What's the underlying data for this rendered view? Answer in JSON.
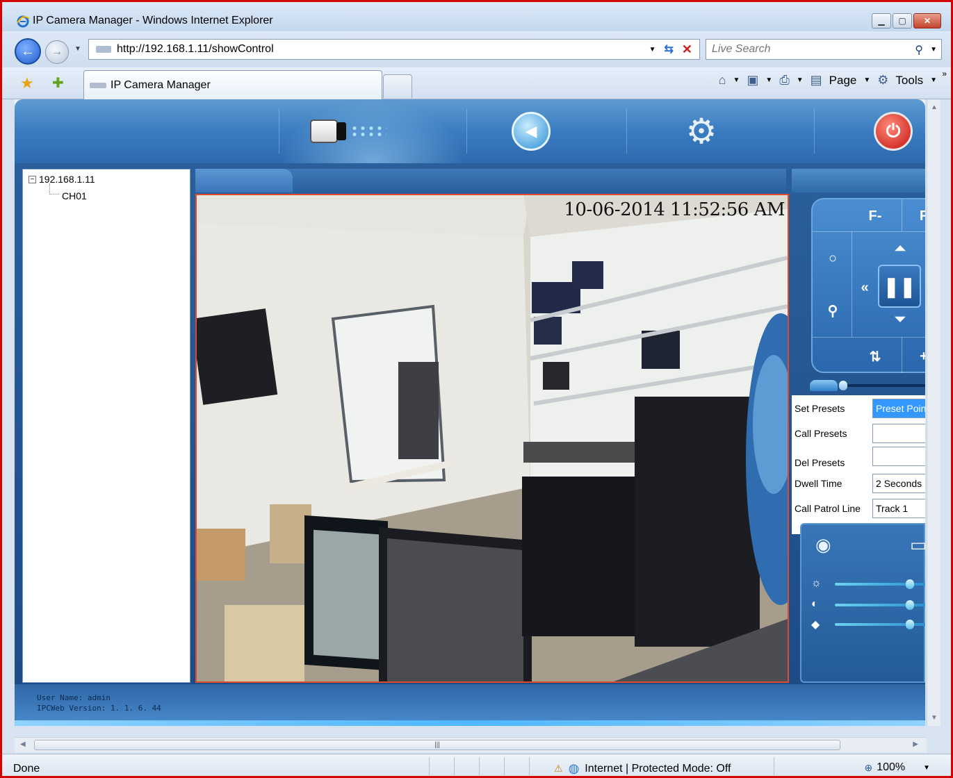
{
  "window": {
    "title": "IP Camera Manager - Windows Internet Explorer"
  },
  "toolbar": {
    "address_url": "http://192.168.1.11/showControl",
    "search_placeholder": "Live Search"
  },
  "tabs": [
    {
      "label": "IP Camera Manager"
    }
  ],
  "command_bar": {
    "page_label": "Page",
    "tools_label": "Tools"
  },
  "app": {
    "header_icons": [
      "camera-icon",
      "back-icon",
      "settings-icon",
      "power-icon"
    ],
    "tree": {
      "root": "192.168.1.11",
      "children": [
        "CH01"
      ]
    },
    "video": {
      "timestamp": "10-06-2014 11:52:56 AM"
    },
    "ptz": {
      "focus_minus": "F-",
      "focus_plus": "F"
    },
    "presets": {
      "set_label": "Set Presets",
      "set_value": "Preset Point",
      "call_label": "Call Presets",
      "call_value": "",
      "del_label": "Del Presets",
      "del_value": "",
      "dwell_label": "Dwell Time",
      "dwell_value": "2 Seconds",
      "patrol_label": "Call Patrol Line",
      "patrol_value": "Track 1"
    },
    "image_sliders": {
      "brightness": 0.82,
      "contrast": 0.82,
      "saturation": 0.82
    },
    "footer": {
      "user_line": "User Name: admin",
      "version_line": "IPCWeb Version: 1. 1. 6. 44"
    }
  },
  "statusbar": {
    "status": "Done",
    "zone": "Internet | Protected Mode: Off",
    "zoom": "100%"
  },
  "colors": {
    "frame_border": "#d40000",
    "app_blue": "#2d69ad",
    "video_border": "#e04a2a",
    "selected_input": "#3399ff"
  }
}
